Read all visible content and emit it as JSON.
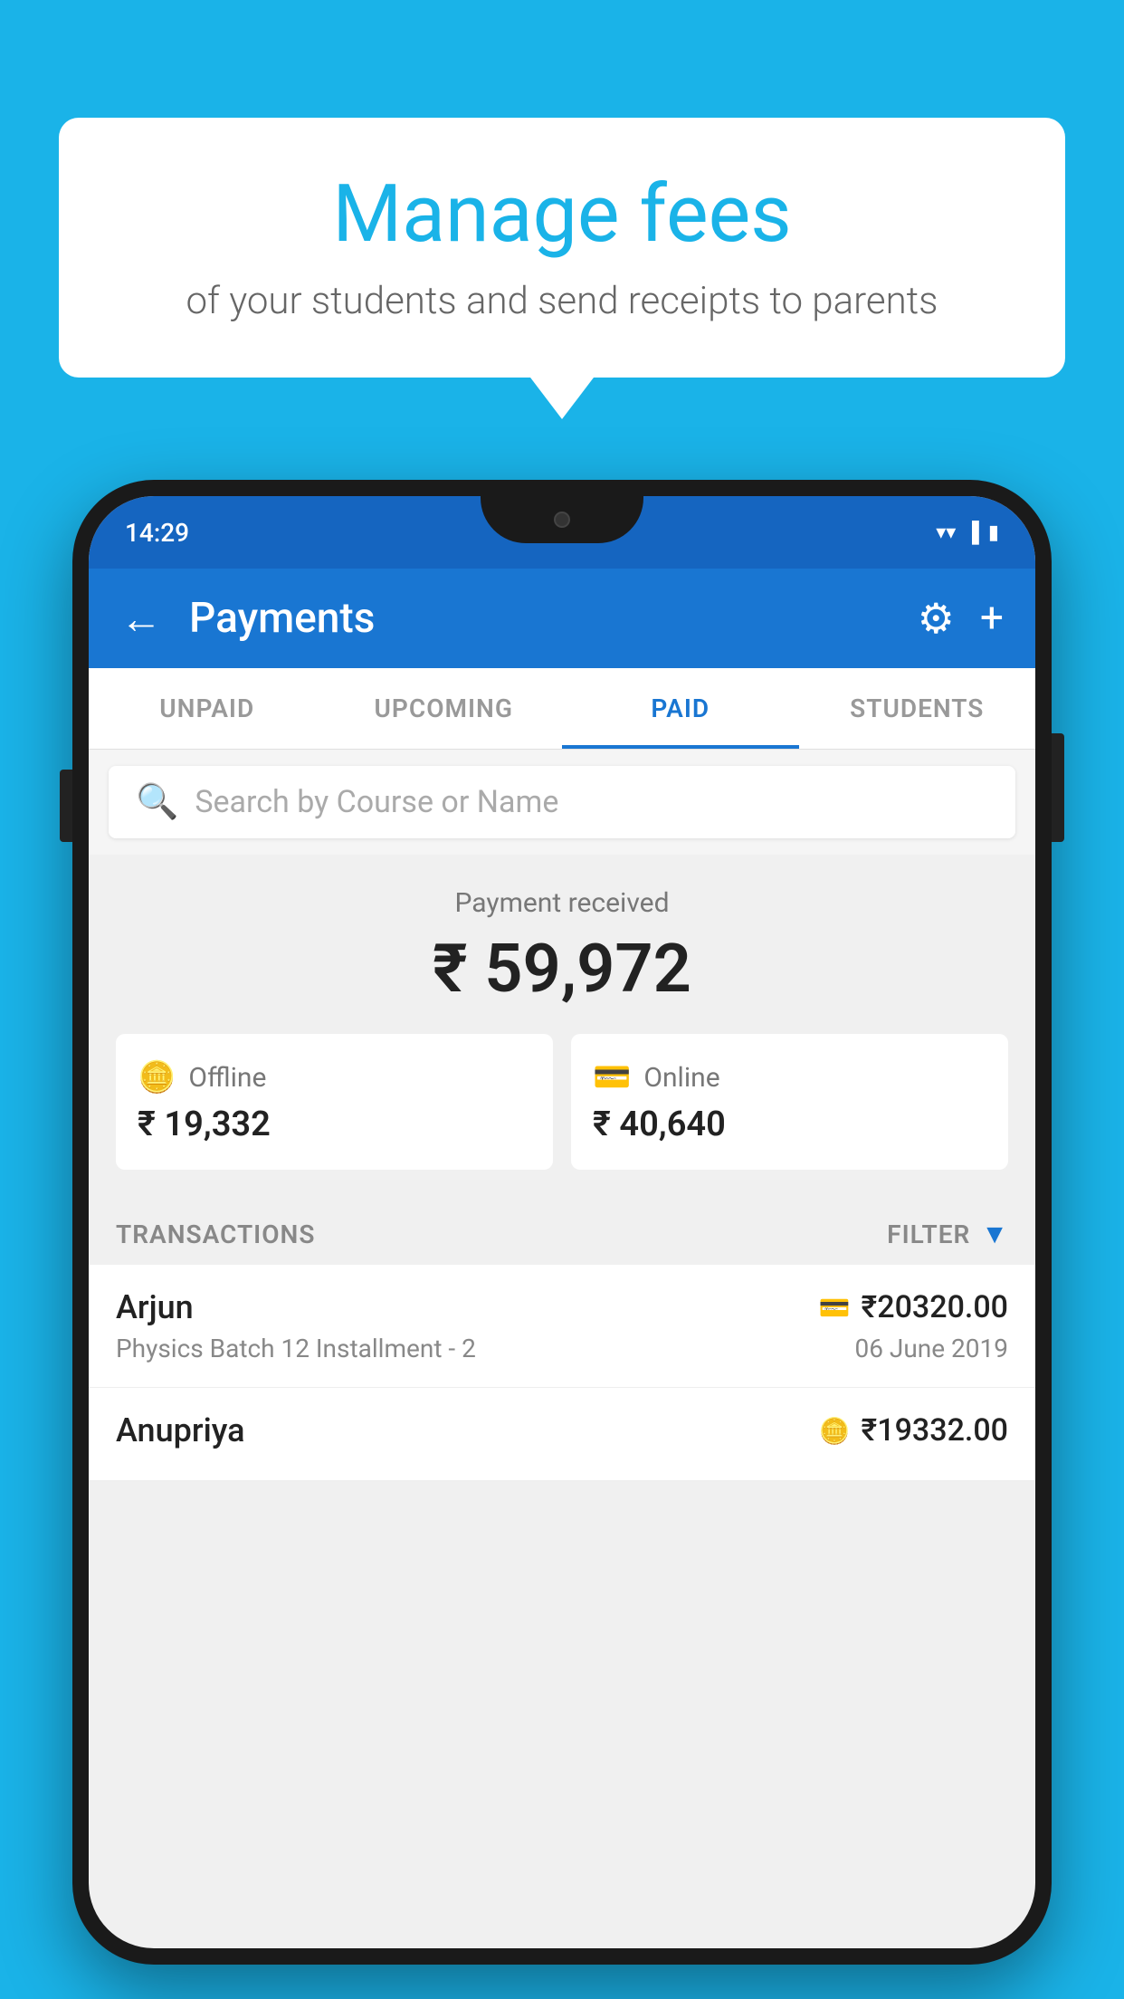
{
  "background_color": "#1ab3e8",
  "speech_bubble": {
    "title": "Manage fees",
    "subtitle": "of your students and send receipts to parents"
  },
  "phone": {
    "status_bar": {
      "time": "14:29",
      "icons": [
        "wifi",
        "signal",
        "battery"
      ]
    },
    "app_bar": {
      "title": "Payments",
      "back_label": "←",
      "gear_label": "⚙",
      "plus_label": "+"
    },
    "tabs": [
      {
        "label": "UNPAID",
        "active": false
      },
      {
        "label": "UPCOMING",
        "active": false
      },
      {
        "label": "PAID",
        "active": true
      },
      {
        "label": "STUDENTS",
        "active": false
      }
    ],
    "search": {
      "placeholder": "Search by Course or Name"
    },
    "payment_summary": {
      "label": "Payment received",
      "amount": "₹ 59,972",
      "offline": {
        "label": "Offline",
        "amount": "₹ 19,332"
      },
      "online": {
        "label": "Online",
        "amount": "₹ 40,640"
      }
    },
    "transactions": {
      "header_label": "TRANSACTIONS",
      "filter_label": "FILTER",
      "rows": [
        {
          "name": "Arjun",
          "detail": "Physics Batch 12 Installment - 2",
          "amount": "₹20320.00",
          "date": "06 June 2019",
          "icon_type": "card"
        },
        {
          "name": "Anupriya",
          "detail": "",
          "amount": "₹19332.00",
          "date": "",
          "icon_type": "cash"
        }
      ]
    }
  }
}
